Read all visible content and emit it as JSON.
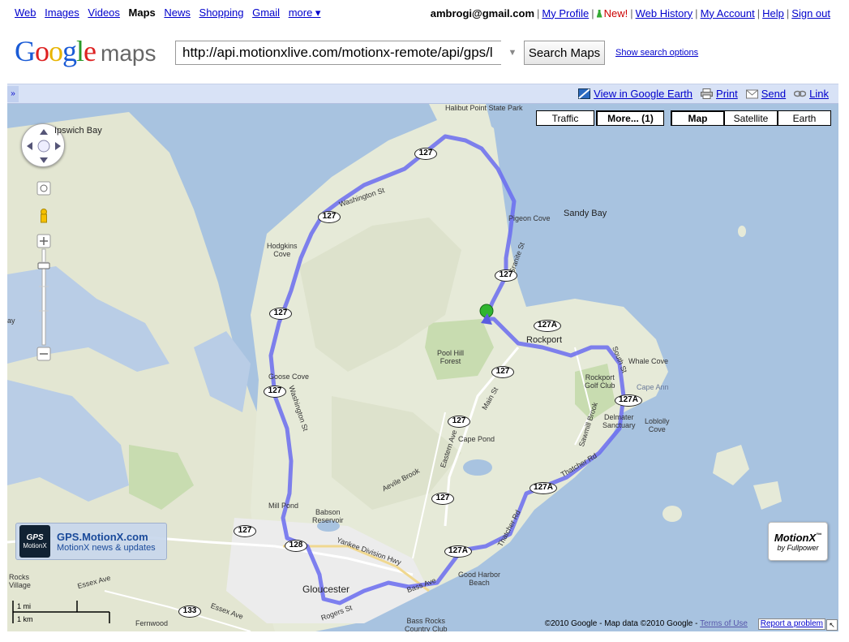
{
  "topnav": {
    "links": [
      "Web",
      "Images",
      "Videos",
      "Maps",
      "News",
      "Shopping",
      "Gmail",
      "more ▾"
    ],
    "active": "Maps",
    "user_email": "ambrogi@gmail.com",
    "my_profile": "My Profile",
    "new_label": "New!",
    "web_history": "Web History",
    "my_account": "My Account",
    "help": "Help",
    "sign_out": "Sign out"
  },
  "header": {
    "logo": "Google",
    "logo_product": "maps",
    "search_value": "http://api.motionxlive.com/motionx-remote/api/gps/l",
    "search_button": "Search Maps",
    "search_options": "Show search options"
  },
  "toolbar": {
    "collapse": "»",
    "view_in_earth": "View in Google Earth",
    "print": "Print",
    "send": "Send",
    "link": "Link"
  },
  "map": {
    "buttons": {
      "traffic": "Traffic",
      "more": "More... (1)",
      "map": "Map",
      "satellite": "Satellite",
      "earth": "Earth"
    },
    "active_type": "Map",
    "labels": {
      "halibut": "Halibut Point\nState Park",
      "ipswich": "Ipswich Bay",
      "sandy_bay": "Sandy Bay",
      "pigeon_cove": "Pigeon Cove",
      "hodgkins_cove": "Hodgkins\nCove",
      "washington_st": "Washington St",
      "granite_st": "Granite St",
      "rockport": "Rockport",
      "pool_hill": "Pool Hill\nForest",
      "whale_cove": "Whale Cove",
      "cape_ann": "Cape Ann",
      "rockport_golf": "Rockport\nGolf Club",
      "delmater": "Delmater\nSanctuary",
      "loblolly": "Loblolly\nCove",
      "goose_cove": "Goose Cove",
      "cape_pond": "Cape Pond",
      "main_st": "Main St",
      "eastern_ave": "Eastern Ave",
      "sawmill_brook": "Sawmill Brook",
      "thatcher_rd": "Thatcher Rd",
      "thatcher_rd2": "Thatcher Rd",
      "aevile_brook": "Aevile Brook",
      "mill_pond": "Mill Pond",
      "babson": "Babson\nReservoir",
      "yankee_div": "Yankee Division Hwy",
      "gloucester": "Gloucester",
      "good_harbor": "Good Harbor\nBeach",
      "bass_ave": "Bass Ave",
      "rogers_st": "Rogers St",
      "bass_rocks": "Bass Rocks\nCountry Club",
      "fernwood": "Fernwood",
      "essex_ave": "Essex Ave",
      "essex_ave2": "Essex Ave",
      "rocks": "Rocks\nVillage",
      "south_st": "South St",
      "bay": "ay",
      "washington_st2": "Washington St"
    },
    "shields": [
      "127",
      "127",
      "127",
      "127",
      "127",
      "127A",
      "127",
      "127A",
      "127",
      "127A",
      "127",
      "127",
      "128",
      "127A",
      "133"
    ],
    "promo_title": "GPS.MotionX.com",
    "promo_sub": "MotionX news & updates",
    "promo_badge_top": "GPS",
    "promo_badge_bottom": "MotionX",
    "motionx_logo": "MotionX",
    "motionx_tm": "™",
    "motionx_by": "by Fullpower",
    "copyright": "©2010 Google - Map data ©2010 Google -",
    "terms": "Terms of Use",
    "report": "Report a problem",
    "scale_mi": "1 mi",
    "scale_km": "1 km"
  },
  "colors": {
    "route": "#6a6cf0",
    "water": "#a8c3e0",
    "land": "#e6ead8",
    "forest": "#c8dcb0",
    "link": "#0000cc",
    "toolbar_bg": "#d8e2f6"
  }
}
